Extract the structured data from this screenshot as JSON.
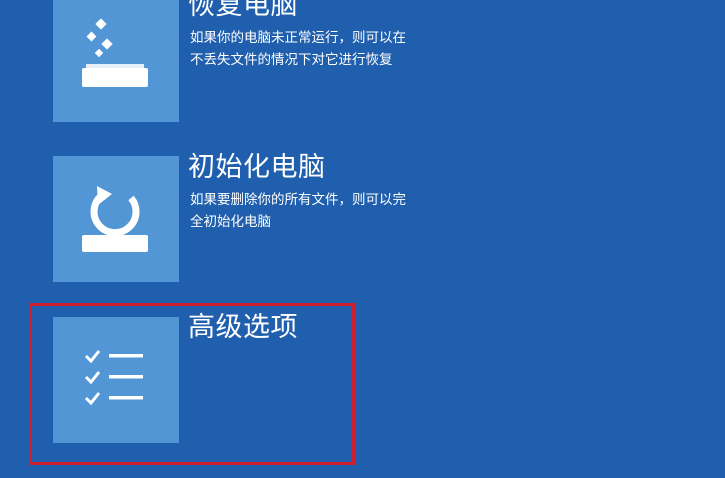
{
  "options": [
    {
      "id": "refresh",
      "title": "恢复电脑",
      "description": "如果你的电脑未正常运行，则可以在\n不丢失文件的情况下对它进行恢复",
      "icon": "refresh-pc-icon"
    },
    {
      "id": "reset",
      "title": "初始化电脑",
      "description": "如果要删除你的所有文件，则可以完\n全初始化电脑",
      "icon": "reset-pc-icon"
    },
    {
      "id": "advanced",
      "title": "高级选项",
      "description": "",
      "icon": "checklist-icon"
    }
  ],
  "colors": {
    "background": "#1f5fae",
    "tile": "#5296d6",
    "highlight": "#cf1f2e",
    "text": "#ffffff"
  }
}
